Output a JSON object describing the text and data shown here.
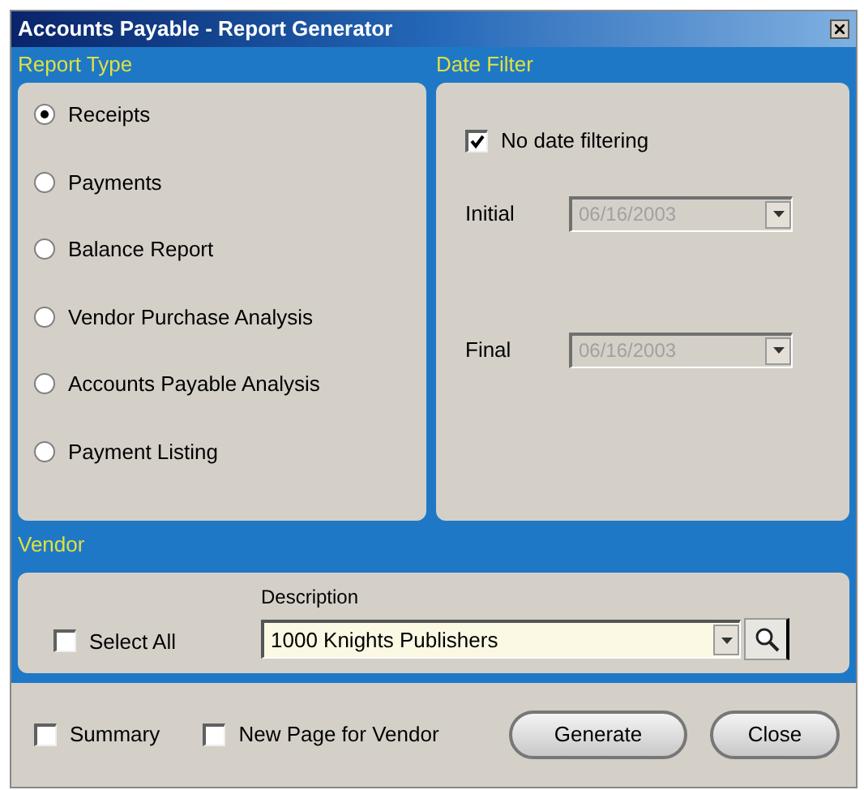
{
  "window": {
    "title": "Accounts Payable - Report Generator"
  },
  "report_type": {
    "heading": "Report Type",
    "options": [
      {
        "label": "Receipts",
        "selected": true
      },
      {
        "label": "Payments",
        "selected": false
      },
      {
        "label": "Balance Report",
        "selected": false
      },
      {
        "label": "Vendor Purchase Analysis",
        "selected": false
      },
      {
        "label": "Accounts Payable Analysis",
        "selected": false
      },
      {
        "label": "Payment Listing",
        "selected": false
      }
    ]
  },
  "date_filter": {
    "heading": "Date Filter",
    "no_filter": {
      "label": "No date filtering",
      "checked": true
    },
    "fields": [
      {
        "label": "Initial",
        "value": "06/16/2003",
        "disabled": true
      },
      {
        "label": "Final",
        "value": "06/16/2003",
        "disabled": true
      }
    ]
  },
  "vendor": {
    "heading": "Vendor",
    "select_all": {
      "label": "Select All",
      "checked": false
    },
    "description_label": "Description",
    "description_value": "1000 Knights Publishers"
  },
  "options": [
    {
      "label": "Summary",
      "checked": false
    },
    {
      "label": "New Page for Vendor",
      "checked": false
    }
  ],
  "buttons": [
    "Generate",
    "Close"
  ]
}
